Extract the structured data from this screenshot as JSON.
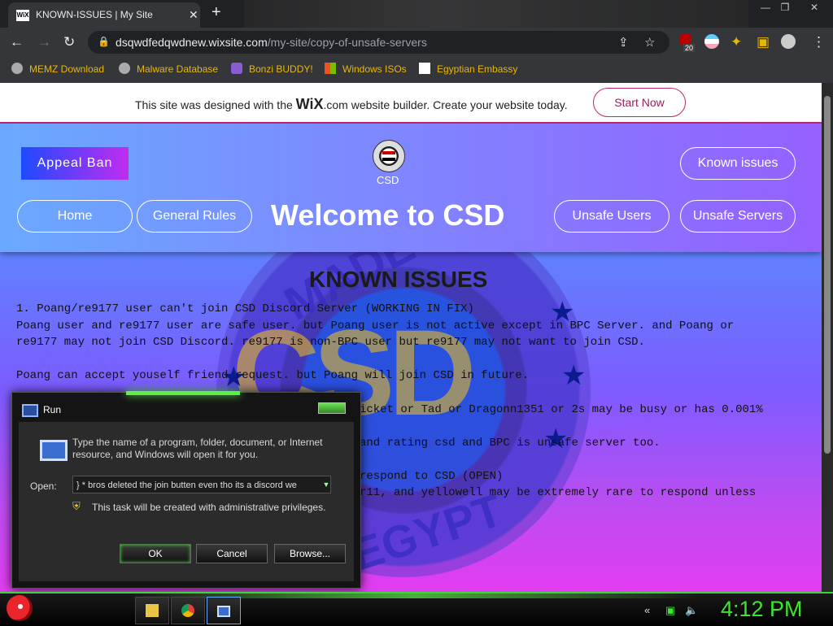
{
  "browser": {
    "tab_title": "KNOWN-ISSUES | My Site",
    "tab_favicon": "WiX",
    "url_domain": "dsqwdfedqwdnew.wixsite.com",
    "url_path": "/my-site/copy-of-unsafe-servers",
    "ext_badge": "20",
    "bookmarks": [
      {
        "label": "MEMZ Download",
        "icon": "globe-icon"
      },
      {
        "label": "Malware Database",
        "icon": "globe-icon"
      },
      {
        "label": "Bonzi BUDDY!",
        "icon": "bonzi-icon"
      },
      {
        "label": "Windows ISOs",
        "icon": "windows-logo-icon"
      },
      {
        "label": "Egyptian Embassy",
        "icon": "wix-icon"
      }
    ]
  },
  "wix_banner": {
    "text_before": "This site was designed with the",
    "brand": "WiX",
    "text_after": ".com website builder. Create your website today.",
    "button": "Start Now"
  },
  "header": {
    "appeal_button": "Appeal Ban",
    "known_issues_button": "Known issues",
    "logo_caption": "CSD",
    "welcome": "Welcome to CSD",
    "nav": [
      "Home",
      "General Rules",
      "Unsafe Users",
      "Unsafe Servers"
    ]
  },
  "watermark": {
    "top": "MADE IN",
    "middle": "CSD",
    "bottom": "EGYPT"
  },
  "content": {
    "title": "KNOWN ISSUES",
    "lines": [
      "1. Poang/re9177 user can't join CSD Discord Server (WORKING IN FIX)",
      "Poang user and re9177 user are safe user. but Poang user is not active except in BPC Server. and Poang or",
      "re9177 may not join CSD Discord. re9177 is non-BPC user but re9177 may not want to join CSD.",
      "Poang can accept youself friend request. but Poang will join CSD in future.",
      "icket or Tad or Dragonn1351 or 2s may be busy or has 0.001%",
      "and rating csd and BPC is unsafe server too.",
      "respond to CSD (OPEN)",
      "r11, and yellowell may be extremely rare to respond unless"
    ]
  },
  "run_dialog": {
    "title": "Run",
    "description": "Type the name of a program, folder, document, or Internet resource, and Windows will open it for you.",
    "open_label": "Open:",
    "open_value": "} * bros deleted the join butten even tho its a discord we",
    "admin_note": "This task will be created with administrative privileges.",
    "ok": "OK",
    "cancel": "Cancel",
    "browse": "Browse..."
  },
  "taskbar": {
    "clock": "4:12 PM",
    "pinned": [
      "file-explorer-icon",
      "chrome-icon",
      "run-icon"
    ]
  },
  "colors": {
    "accent_pink": "#c0266d",
    "clock_green": "#3ee52e",
    "bookmark_yellow": "#e8b60a"
  }
}
